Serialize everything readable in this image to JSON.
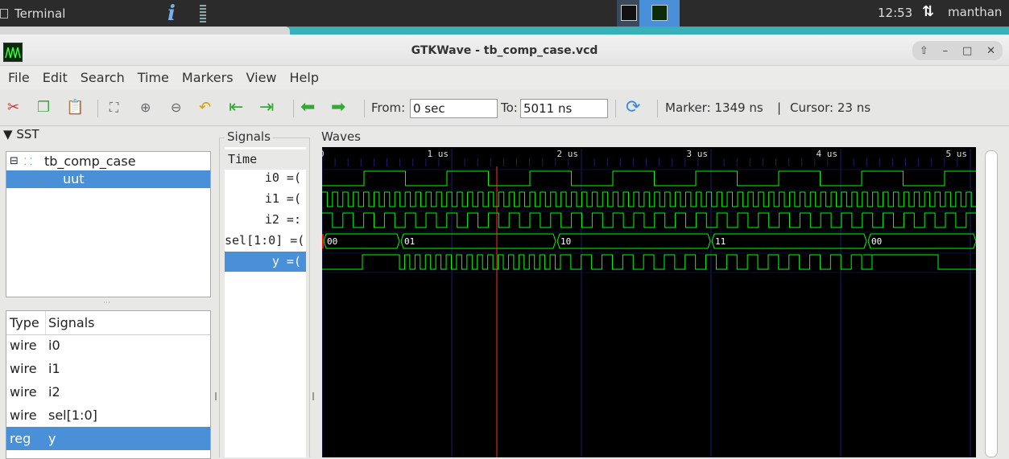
{
  "taskbar": {
    "terminal_label": "Terminal",
    "clock": "12:53",
    "user": "manthan"
  },
  "window": {
    "title": "GTKWave - tb_comp_case.vcd"
  },
  "menu": [
    "File",
    "Edit",
    "Search",
    "Time",
    "Markers",
    "View",
    "Help"
  ],
  "toolbar": {
    "from_label": "From:",
    "from_value": "0 sec",
    "to_label": "To:",
    "to_value": "5011 ns",
    "marker_text": "Marker: 1349 ns",
    "separator": "|",
    "cursor_text": "Cursor: 23 ns"
  },
  "sst": {
    "header": "SST",
    "tree": [
      {
        "label": "tb_comp_case",
        "selected": false
      },
      {
        "label": "uut",
        "selected": true
      }
    ],
    "columns": [
      "Type",
      "Signals"
    ],
    "rows": [
      {
        "type": "wire",
        "name": "i0",
        "selected": false
      },
      {
        "type": "wire",
        "name": "i1",
        "selected": false
      },
      {
        "type": "wire",
        "name": "i2",
        "selected": false
      },
      {
        "type": "wire",
        "name": "sel[1:0]",
        "selected": false
      },
      {
        "type": "reg",
        "name": "y",
        "selected": true
      }
    ]
  },
  "signals_pane": {
    "label": "Signals",
    "time_header": "Time",
    "rows": [
      {
        "name": "i0 =(",
        "selected": false
      },
      {
        "name": "i1 =(",
        "selected": false
      },
      {
        "name": "i2 =:",
        "selected": false
      },
      {
        "name": "sel[1:0] =(",
        "selected": false
      },
      {
        "name": "y =(",
        "selected": true
      }
    ]
  },
  "waves_pane": {
    "label": "Waves",
    "timeline_labels": [
      "0",
      "1 us",
      "2 us",
      "3 us",
      "4 us",
      "5 us"
    ],
    "sel_bus_values": [
      "00",
      "01",
      "10",
      "11",
      "00"
    ],
    "colors": {
      "wave": "#00ff00",
      "grid": "#1c1c6e",
      "cursor": "#ff3030",
      "background": "#000000",
      "bus_change": "#ff0000"
    }
  }
}
